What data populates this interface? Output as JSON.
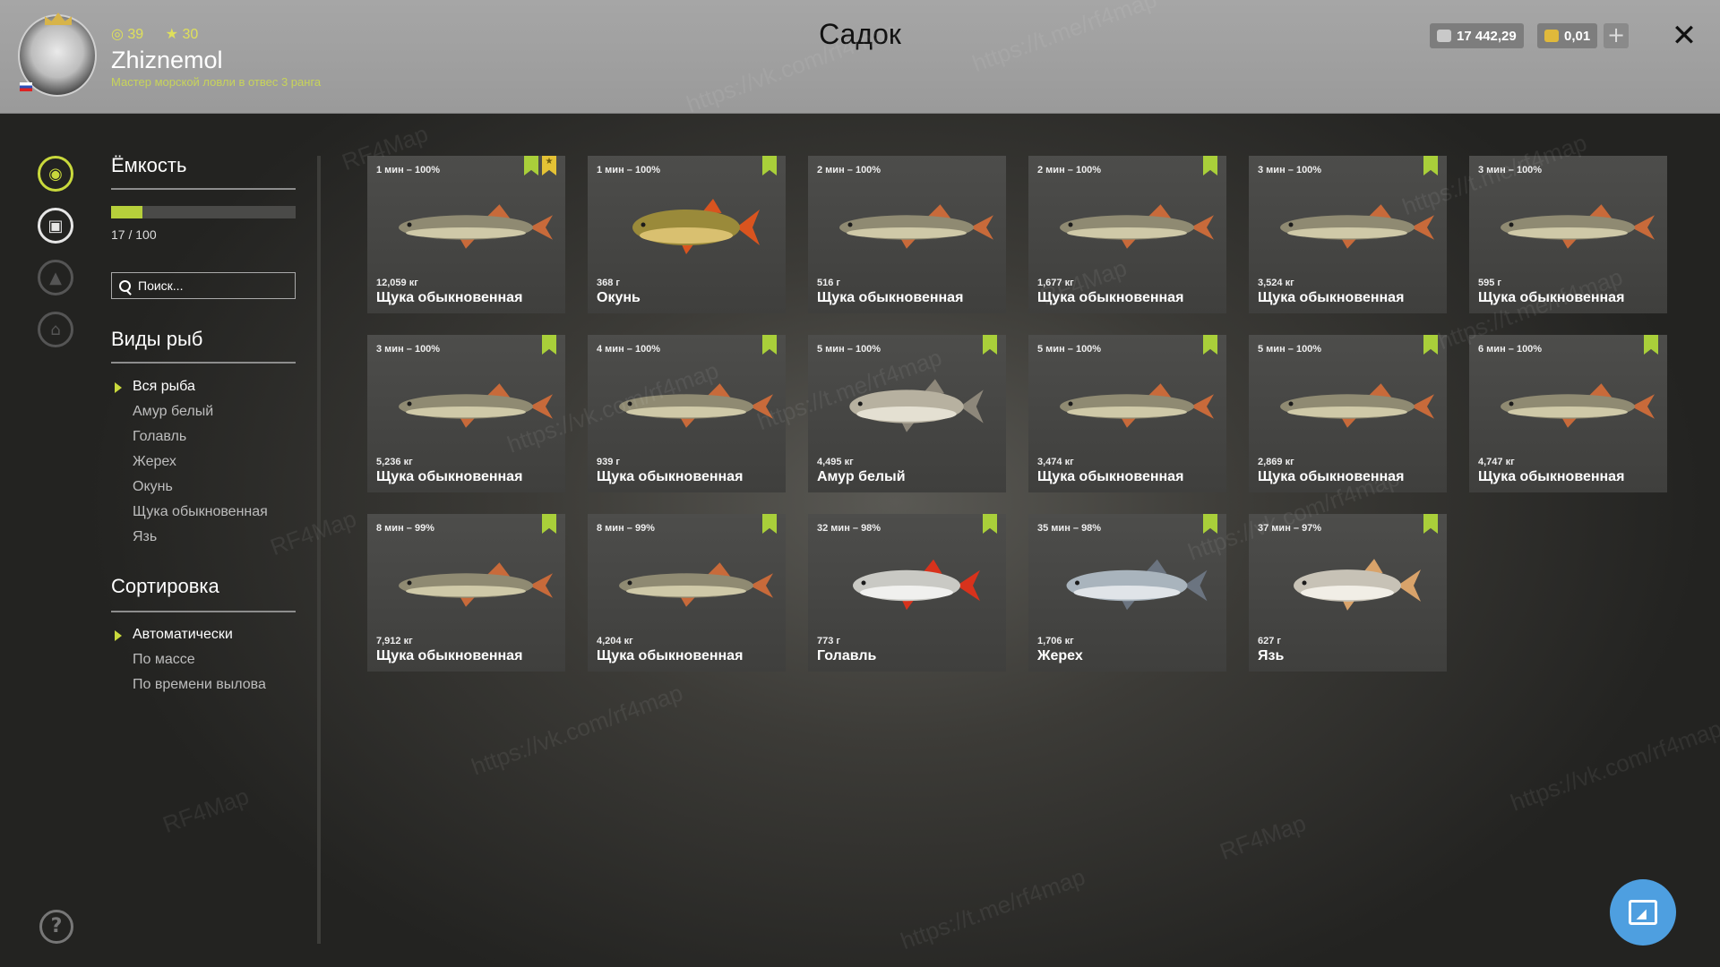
{
  "header": {
    "title": "Садок",
    "player": {
      "level": "39",
      "rating": "30",
      "name": "Zhiznemol",
      "rank_title": "Мастер морской ловли в отвес 3 ранга"
    },
    "currency": {
      "silver": "17 442,29",
      "gold": "0,01",
      "add_label": "+"
    },
    "close_label": "✕"
  },
  "sidebar_icons": [
    {
      "name": "fish-keepnet-icon",
      "state": "active"
    },
    {
      "name": "backpack-icon",
      "state": "white"
    },
    {
      "name": "tent-icon",
      "state": "dim"
    },
    {
      "name": "home-icon",
      "state": "dim"
    }
  ],
  "filters": {
    "capacity": {
      "title": "Ёмкость",
      "used": 17,
      "max": 100,
      "fill_fraction": 0.17,
      "text": "17 / 100"
    },
    "search": {
      "placeholder": "Поиск..."
    },
    "species": {
      "title": "Виды рыб",
      "items": [
        "Вся рыба",
        "Амур белый",
        "Голавль",
        "Жерех",
        "Окунь",
        "Щука обыкновенная",
        "Язь"
      ],
      "selected": "Вся рыба"
    },
    "sorting": {
      "title": "Сортировка",
      "items": [
        "Автоматически",
        "По массе",
        "По времени вылова"
      ],
      "selected": "Автоматически"
    }
  },
  "fish": [
    {
      "time": "1 мин – 100%",
      "weight": "12,059 кг",
      "name": "Щука обыкновенная",
      "kind": "pike",
      "marks": [
        "bookmark",
        "star"
      ]
    },
    {
      "time": "1 мин – 100%",
      "weight": "368 г",
      "name": "Окунь",
      "kind": "perch",
      "marks": [
        "bookmark"
      ]
    },
    {
      "time": "2 мин – 100%",
      "weight": "516 г",
      "name": "Щука обыкновенная",
      "kind": "pike",
      "marks": []
    },
    {
      "time": "2 мин – 100%",
      "weight": "1,677 кг",
      "name": "Щука обыкновенная",
      "kind": "pike",
      "marks": [
        "bookmark"
      ]
    },
    {
      "time": "3 мин – 100%",
      "weight": "3,524 кг",
      "name": "Щука обыкновенная",
      "kind": "pike",
      "marks": [
        "bookmark"
      ]
    },
    {
      "time": "3 мин – 100%",
      "weight": "595 г",
      "name": "Щука обыкновенная",
      "kind": "pike",
      "marks": []
    },
    {
      "time": "3 мин – 100%",
      "weight": "5,236 кг",
      "name": "Щука обыкновенная",
      "kind": "pike",
      "marks": [
        "bookmark"
      ]
    },
    {
      "time": "4 мин – 100%",
      "weight": "939 г",
      "name": "Щука обыкновенная",
      "kind": "pike",
      "marks": [
        "bookmark"
      ]
    },
    {
      "time": "5 мин – 100%",
      "weight": "4,495 кг",
      "name": "Амур белый",
      "kind": "carp",
      "marks": [
        "bookmark"
      ]
    },
    {
      "time": "5 мин – 100%",
      "weight": "3,474 кг",
      "name": "Щука обыкновенная",
      "kind": "pike",
      "marks": [
        "bookmark"
      ]
    },
    {
      "time": "5 мин – 100%",
      "weight": "2,869 кг",
      "name": "Щука обыкновенная",
      "kind": "pike",
      "marks": [
        "bookmark"
      ]
    },
    {
      "time": "6 мин – 100%",
      "weight": "4,747 кг",
      "name": "Щука обыкновенная",
      "kind": "pike",
      "marks": [
        "bookmark"
      ]
    },
    {
      "time": "8 мин – 99%",
      "weight": "7,912 кг",
      "name": "Щука обыкновенная",
      "kind": "pike",
      "marks": [
        "bookmark"
      ]
    },
    {
      "time": "8 мин – 99%",
      "weight": "4,204 кг",
      "name": "Щука обыкновенная",
      "kind": "pike",
      "marks": [
        "bookmark"
      ]
    },
    {
      "time": "32 мин – 98%",
      "weight": "773 г",
      "name": "Голавль",
      "kind": "chub",
      "marks": [
        "bookmark"
      ]
    },
    {
      "time": "35 мин – 98%",
      "weight": "1,706 кг",
      "name": "Жерех",
      "kind": "asp",
      "marks": [
        "bookmark"
      ]
    },
    {
      "time": "37 мин – 97%",
      "weight": "627 г",
      "name": "Язь",
      "kind": "ide",
      "marks": [
        "bookmark"
      ]
    }
  ],
  "watermarks": [
    "RF4Map",
    "https://vk.com/rf4map",
    "https://t.me/rf4map"
  ],
  "colors": {
    "accent": "#c9d93c",
    "bookmark": "#a9cf3a",
    "star": "#e4c235",
    "fab": "#4e9fe0"
  }
}
